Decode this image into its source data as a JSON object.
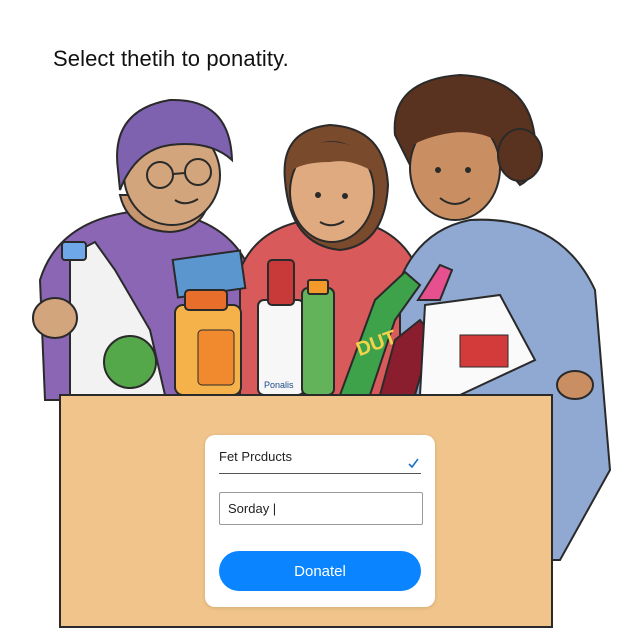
{
  "prompt": {
    "text": "Select thetih to ponatity."
  },
  "form": {
    "select_label": "Fet Prcducts",
    "input_value": "Sorday |",
    "donate_label": "Donatel"
  },
  "bottle_label": "DUT",
  "carton_label": "Ponalis",
  "colors": {
    "box": "#f0c48a",
    "button": "#0a84ff",
    "check": "#1a73c8"
  },
  "icons": {
    "check": "checkmark-icon"
  }
}
